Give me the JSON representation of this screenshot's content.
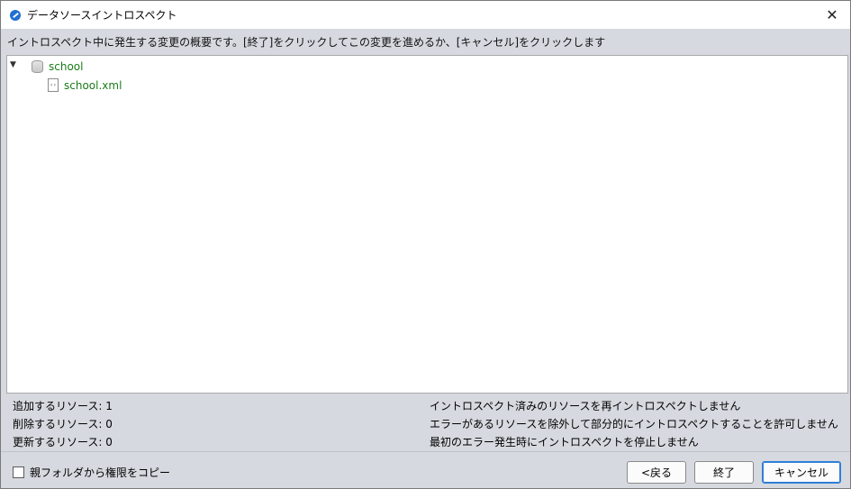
{
  "window": {
    "title": "データソースイントロスペクト",
    "close_glyph": "✕"
  },
  "description": "イントロスペクト中に発生する変更の概要です。[終了]をクリックしてこの変更を進めるか、[キャンセル]をクリックします",
  "tree": {
    "toggle_glyph": "▼",
    "root": {
      "label": "school",
      "icon": "database-icon"
    },
    "child": {
      "label": "school.xml",
      "icon": "xml-file-icon",
      "icon_glyph": "‹›"
    },
    "label_color": "#1a7a1a"
  },
  "stats": [
    "追加するリソース: 1",
    "削除するリソース: 0",
    "更新するリソース: 0"
  ],
  "options": [
    "イントロスペクト済みのリソースを再イントロスペクトしません",
    "エラーがあるリソースを除外して部分的にイントロスペクトすることを許可しません",
    "最初のエラー発生時にイントロスペクトを停止しません"
  ],
  "footer": {
    "checkbox_label": "親フォルダから権限をコピー",
    "back_label": "<戻る",
    "finish_label": "終了",
    "cancel_label": "キャンセル"
  },
  "colors": {
    "accent": "#2f7ed8",
    "tree_text": "#1a7a1a"
  }
}
